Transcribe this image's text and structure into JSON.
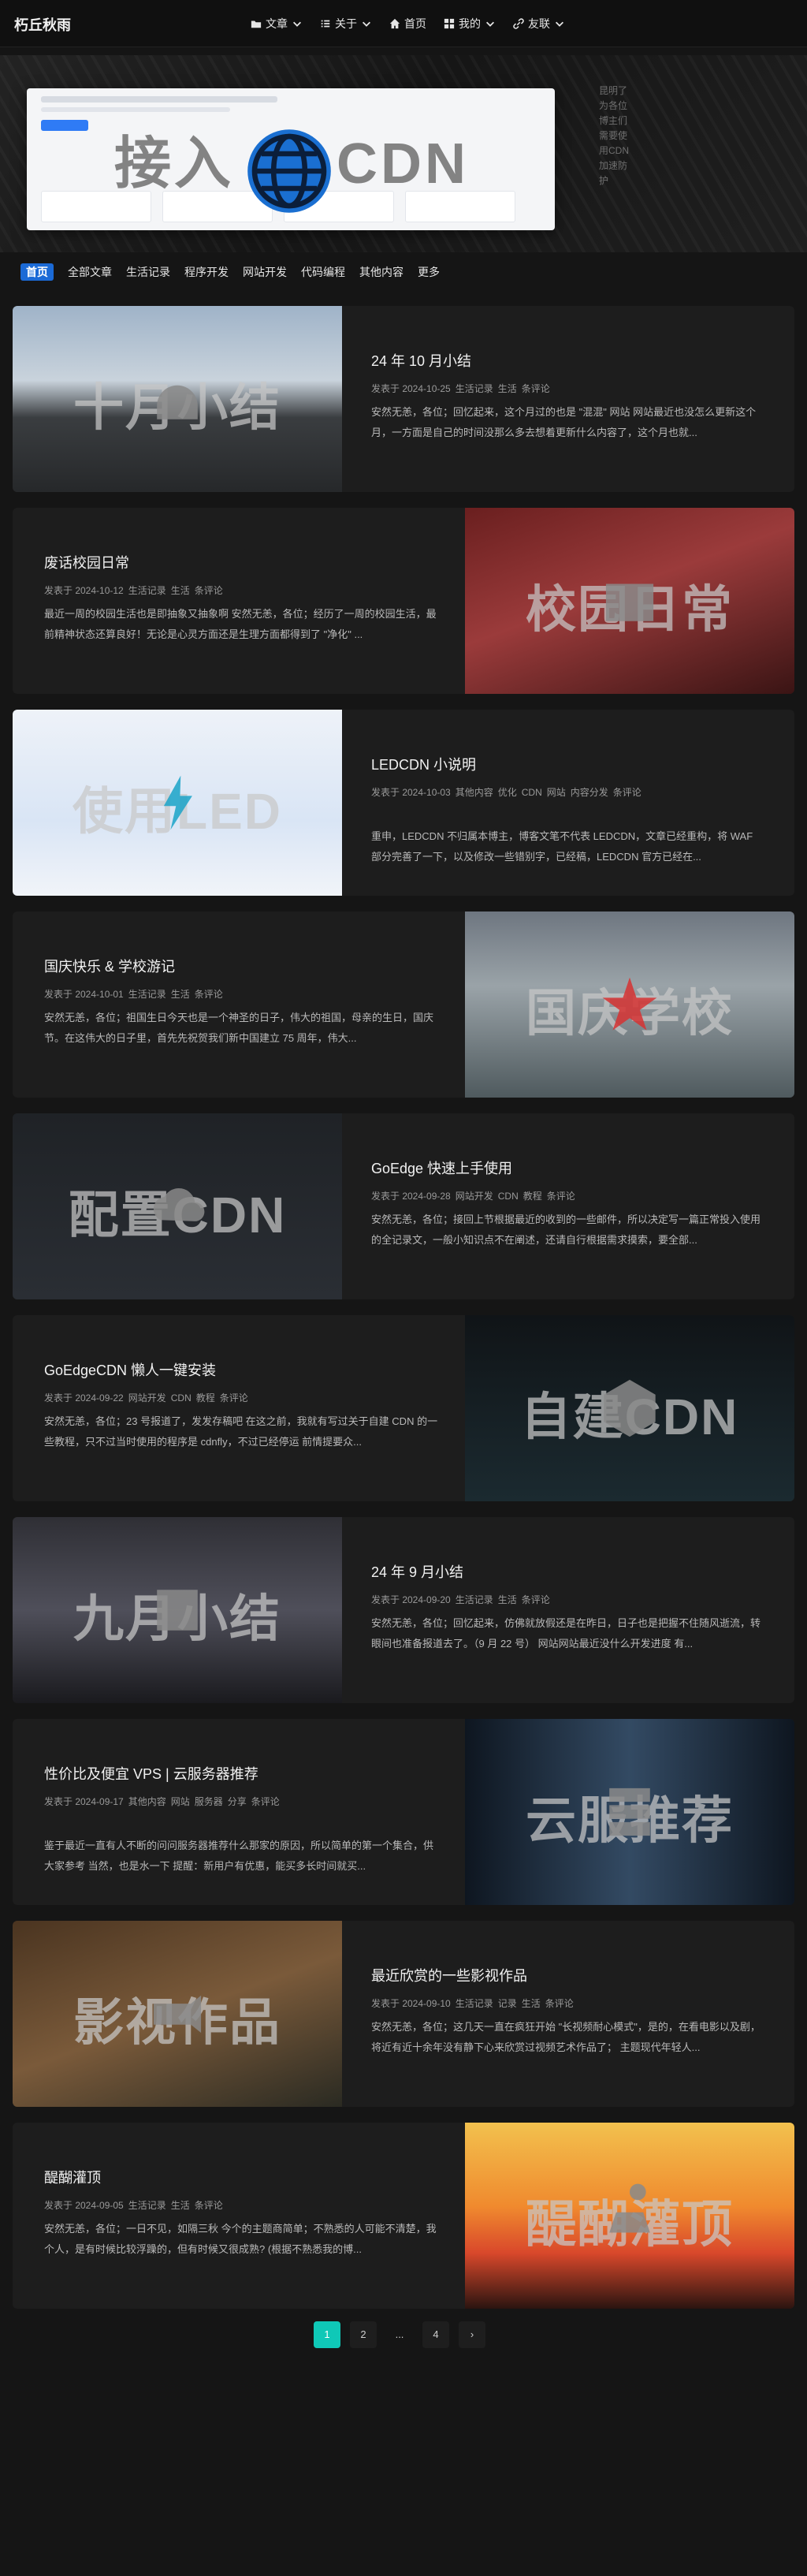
{
  "brand": "朽丘秋雨",
  "nav": [
    {
      "label": "文章",
      "icon": "folder-icon",
      "dropdown": true
    },
    {
      "label": "关于",
      "icon": "list-icon",
      "dropdown": true
    },
    {
      "label": "首页",
      "icon": "home-icon",
      "dropdown": false
    },
    {
      "label": "我的",
      "icon": "grid-icon",
      "dropdown": true
    },
    {
      "label": "友联",
      "icon": "link-icon",
      "dropdown": true
    }
  ],
  "hero": {
    "title_left": "接入",
    "title_right": "CDN",
    "side_text": "昆明了为各位博主们需要使用CDN加速防护"
  },
  "tabs": [
    {
      "label": "首页",
      "active": true
    },
    {
      "label": "全部文章"
    },
    {
      "label": "生活记录"
    },
    {
      "label": "程序开发"
    },
    {
      "label": "网站开发"
    },
    {
      "label": "代码编程"
    },
    {
      "label": "其他内容"
    },
    {
      "label": "更多"
    }
  ],
  "posts": [
    {
      "title": "24 年 10 月小结",
      "thumb_text": "十月小结",
      "meta": [
        "发表于 2024-10-25",
        "生活记录",
        "生活",
        "条评论"
      ],
      "excerpt": "安然无恙，各位；回忆起来，这个月过的也是 \"混混\" 网站 网站最近也没怎么更新这个月，一方面是自己的时间没那么多去想着更新什么内容了，这个月也就..."
    },
    {
      "title": "废话校园日常",
      "thumb_text": "校园日常",
      "meta": [
        "发表于 2024-10-12",
        "生活记录",
        "生活",
        "条评论"
      ],
      "excerpt": "最近一周的校园生活也是即抽象又抽象啊 安然无恙，各位；经历了一周的校园生活，最前精神状态还算良好！无论是心灵方面还是生理方面都得到了 \"净化\" ..."
    },
    {
      "title": "LEDCDN 小说明",
      "thumb_text": "使用LED",
      "meta": [
        "发表于 2024-10-03",
        "其他内容",
        "优化",
        "CDN",
        "网站",
        "内容分发",
        "条评论"
      ],
      "excerpt": "重申，LEDCDN 不归属本博主，博客文笔不代表 LEDCDN，文章已经重构，将 WAF 部分完善了一下，以及修改一些错别字，已经稿，LEDCDN 官方已经在..."
    },
    {
      "title": "国庆快乐 & 学校游记",
      "thumb_text": "国庆学校",
      "meta": [
        "发表于 2024-10-01",
        "生活记录",
        "生活",
        "条评论"
      ],
      "excerpt": "安然无恙，各位；祖国生日今天也是一个神圣的日子，伟大的祖国，母亲的生日，国庆节。在这伟大的日子里，首先先祝贺我们新中国建立 75 周年，伟大..."
    },
    {
      "title": "GoEdge 快速上手使用",
      "thumb_text": "配置CDN",
      "meta": [
        "发表于 2024-09-28",
        "网站开发",
        "CDN",
        "教程",
        "条评论"
      ],
      "excerpt": "安然无恙，各位；接回上节根据最近的收到的一些邮件，所以决定写一篇正常投入使用的全记录文，一般小知识点不在阐述，还请自行根据需求摸索，要全部..."
    },
    {
      "title": "GoEdgeCDN 懒人一键安装",
      "thumb_text": "自建CDN",
      "meta": [
        "发表于 2024-09-22",
        "网站开发",
        "CDN",
        "教程",
        "条评论"
      ],
      "excerpt": "安然无恙，各位；23 号报道了，发发存稿吧 在这之前，我就有写过关于自建 CDN 的一些教程，只不过当时使用的程序是 cdnfly，不过已经停运 前情提要众..."
    },
    {
      "title": "24 年 9 月小结",
      "thumb_text": "九月小结",
      "meta": [
        "发表于 2024-09-20",
        "生活记录",
        "生活",
        "条评论"
      ],
      "excerpt": "安然无恙，各位；回忆起来，仿佛就放假还是在昨日，日子也是把握不住随风逝流，转眼间也准备报道去了。（9 月 22 号） 网站网站最近没什么开发进度 有..."
    },
    {
      "title": "性价比及便宜 VPS | 云服务器推荐",
      "thumb_text": "云服推荐",
      "meta": [
        "发表于 2024-09-17",
        "其他内容",
        "网站",
        "服务器",
        "分享",
        "条评论"
      ],
      "excerpt": "鉴于最近一直有人不断的问问服务器推荐什么那家的原因，所以简单的第一个集合，供大家参考 当然，也是水一下 提醒：新用户有优惠，能买多长时间就买..."
    },
    {
      "title": "最近欣赏的一些影视作品",
      "thumb_text": "影视作品",
      "meta": [
        "发表于 2024-09-10",
        "生活记录",
        "记录",
        "生活",
        "条评论"
      ],
      "excerpt": "安然无恙，各位；这几天一直在疯狂开始 \"长视频耐心模式\"，是的，在看电影以及剧，将近有近十余年没有静下心来欣赏过视频艺术作品了； 主题现代年轻人..."
    },
    {
      "title": "醍醐灌顶",
      "thumb_text": "醍醐灌顶",
      "meta": [
        "发表于 2024-09-05",
        "生活记录",
        "生活",
        "条评论"
      ],
      "excerpt": "安然无恙，各位；一日不见，如隔三秋 今个的主题商简单；不熟悉的人可能不清楚，我个人，是有时候比较浮躁的，但有时候又很成熟? (根据不熟悉我的博..."
    }
  ],
  "pagination": [
    "1",
    "2",
    "...",
    "4",
    "›"
  ],
  "colors": {
    "accent": "#0fc8b7",
    "tab_active": "#1b6ad6",
    "background": "#151515"
  }
}
